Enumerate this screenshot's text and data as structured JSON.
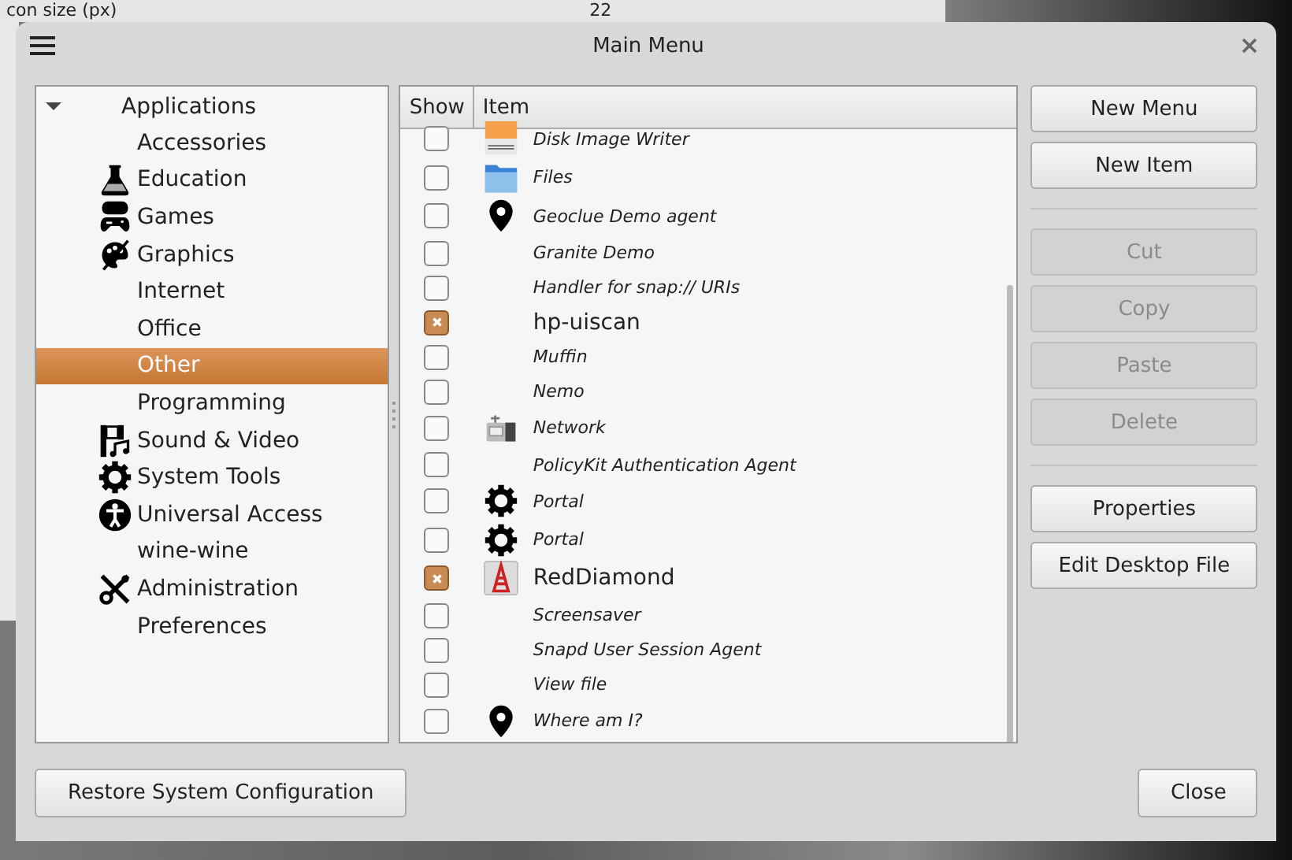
{
  "background": {
    "top_texts": [
      "con size (px)",
      "22"
    ]
  },
  "window": {
    "title": "Main Menu"
  },
  "categories": {
    "root": "Applications",
    "expanded": true,
    "children": [
      {
        "label": "Accessories",
        "kind": "none",
        "selected": false
      },
      {
        "label": "Education",
        "kind": "flask",
        "selected": false
      },
      {
        "label": "Games",
        "kind": "gamepad",
        "selected": false
      },
      {
        "label": "Graphics",
        "kind": "palette",
        "selected": false
      },
      {
        "label": "Internet",
        "kind": "none",
        "selected": false
      },
      {
        "label": "Office",
        "kind": "none",
        "selected": false
      },
      {
        "label": "Other",
        "kind": "none",
        "selected": true
      },
      {
        "label": "Programming",
        "kind": "none",
        "selected": false
      },
      {
        "label": "Sound & Video",
        "kind": "film",
        "selected": false
      },
      {
        "label": "System Tools",
        "kind": "gear",
        "selected": false
      },
      {
        "label": "Universal Access",
        "kind": "person",
        "selected": false
      },
      {
        "label": "wine-wine",
        "kind": "none",
        "selected": false
      },
      {
        "label": "Administration",
        "kind": "tools",
        "selected": false
      },
      {
        "label": "Preferences",
        "kind": "none",
        "selected": false
      }
    ]
  },
  "items": {
    "columns": [
      "Show",
      "Item"
    ],
    "rows": [
      {
        "name": "Disk Image Writer",
        "kind": "disk",
        "checked": false
      },
      {
        "name": "Files",
        "kind": "folder",
        "checked": false
      },
      {
        "name": "Geoclue Demo agent",
        "kind": "pin",
        "checked": false
      },
      {
        "name": "Granite Demo",
        "kind": "none",
        "checked": false
      },
      {
        "name": "Handler for snap:// URIs",
        "kind": "none",
        "checked": false
      },
      {
        "name": "hp-uiscan",
        "kind": "none",
        "checked": true
      },
      {
        "name": "Muffin",
        "kind": "none",
        "checked": false
      },
      {
        "name": "Nemo",
        "kind": "none",
        "checked": false
      },
      {
        "name": "Network",
        "kind": "network",
        "checked": false
      },
      {
        "name": "PolicyKit Authentication Agent",
        "kind": "none",
        "checked": false
      },
      {
        "name": "Portal",
        "kind": "gear",
        "checked": false
      },
      {
        "name": "Portal",
        "kind": "gear",
        "checked": false
      },
      {
        "name": "RedDiamond",
        "kind": "app",
        "checked": true
      },
      {
        "name": "Screensaver",
        "kind": "none",
        "checked": false
      },
      {
        "name": "Snapd User Session Agent",
        "kind": "none",
        "checked": false
      },
      {
        "name": "View file",
        "kind": "none",
        "checked": false
      },
      {
        "name": "Where am I?",
        "kind": "pin",
        "checked": false
      }
    ]
  },
  "action_groups": [
    [
      {
        "label": "New Menu",
        "disabled": false
      },
      {
        "label": "New Item",
        "disabled": false
      }
    ],
    [
      {
        "label": "Cut",
        "disabled": true
      },
      {
        "label": "Copy",
        "disabled": true
      },
      {
        "label": "Paste",
        "disabled": true
      },
      {
        "label": "Delete",
        "disabled": true
      }
    ],
    [
      {
        "label": "Properties",
        "disabled": false
      },
      {
        "label": "Edit Desktop File",
        "disabled": false
      }
    ]
  ],
  "footer": {
    "restore_button": "Restore System Configuration",
    "close_button": "Close"
  }
}
